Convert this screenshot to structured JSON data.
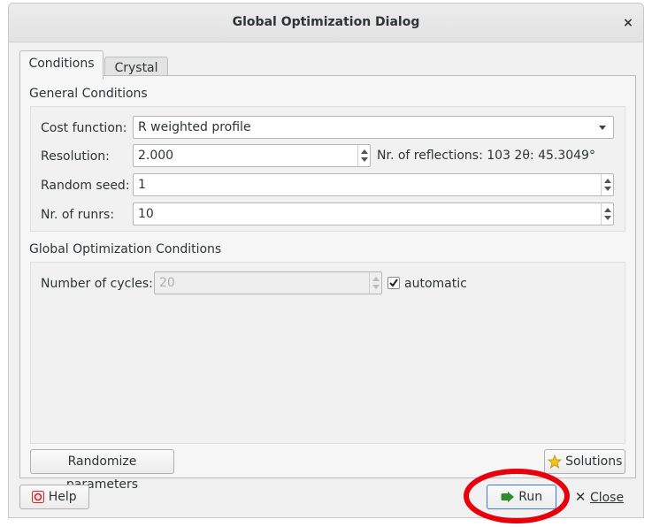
{
  "window": {
    "title": "Global Optimization Dialog",
    "close_glyph": "×"
  },
  "tabs": [
    {
      "label": "Conditions",
      "active": true
    },
    {
      "label": "Crystal",
      "active": false
    }
  ],
  "general": {
    "title": "General Conditions",
    "cost_label": "Cost function:",
    "cost_value": "R weighted profile",
    "resolution_label": "Resolution:",
    "resolution_value": "2.000",
    "reflections_info": "Nr. of reflections: 103 2θ: 45.3049°",
    "seed_label": "Random seed:",
    "seed_value": "1",
    "runs_label": "Nr. of runrs:",
    "runs_value": "10"
  },
  "global": {
    "title": "Global Optimization Conditions",
    "cycles_label": "Number of cycles:",
    "cycles_value": "20",
    "automatic_label": "automatic",
    "automatic_checked": true
  },
  "buttons": {
    "randomize": "Randomize parameters",
    "solutions": "Solutions",
    "help": "Help",
    "run": "Run",
    "close": "Close"
  },
  "icons": {
    "solutions": "star-icon",
    "help": "help-icon",
    "run": "run-icon",
    "close": "close-icon"
  },
  "colors": {
    "annotation_circle": "#e8000d",
    "star": "#f5c518",
    "run_icon": "#2e8b2e"
  }
}
